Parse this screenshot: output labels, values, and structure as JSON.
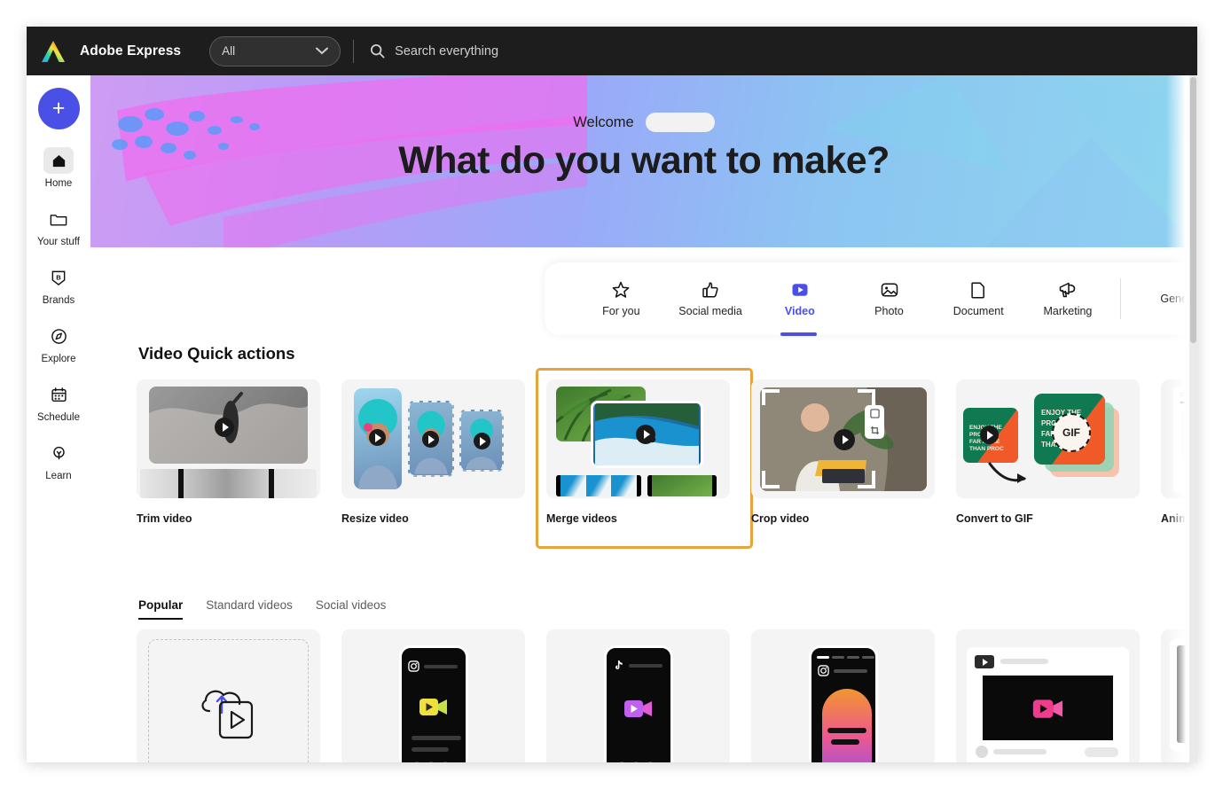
{
  "header": {
    "logo_icon": "adobe-express-logo",
    "brand": "Adobe Express",
    "filter_value": "All",
    "filter_chevron_icon": "chevron-down-icon",
    "search_icon": "search-icon",
    "search_placeholder": "Search everything"
  },
  "sidebar": {
    "create_label": "+",
    "items": [
      {
        "label": "Home",
        "icon": "home-icon",
        "active": true
      },
      {
        "label": "Your stuff",
        "icon": "folder-icon",
        "active": false
      },
      {
        "label": "Brands",
        "icon": "brand-shield-icon",
        "active": false
      },
      {
        "label": "Explore",
        "icon": "compass-icon",
        "active": false
      },
      {
        "label": "Schedule",
        "icon": "calendar-icon",
        "active": false
      },
      {
        "label": "Learn",
        "icon": "lightbulb-icon",
        "active": false
      }
    ]
  },
  "hero": {
    "welcome_label": "Welcome",
    "user_name_redacted": "",
    "headline": "What do you want to make?"
  },
  "categories": [
    {
      "label": "For you",
      "icon": "star-icon",
      "active": false
    },
    {
      "label": "Social media",
      "icon": "thumbs-up-icon",
      "active": false
    },
    {
      "label": "Video",
      "icon": "video-play-icon",
      "active": true
    },
    {
      "label": "Photo",
      "icon": "photo-icon",
      "active": false
    },
    {
      "label": "Document",
      "icon": "document-icon",
      "active": false
    },
    {
      "label": "Marketing",
      "icon": "megaphone-icon",
      "active": false
    },
    {
      "label": "Gene",
      "icon": "generative-icon",
      "active": false
    }
  ],
  "quick_actions": {
    "title": "Video Quick actions",
    "items": [
      {
        "label": "Trim video",
        "selected": false
      },
      {
        "label": "Resize video",
        "selected": false
      },
      {
        "label": "Merge videos",
        "selected": true
      },
      {
        "label": "Crop video",
        "selected": false
      },
      {
        "label": "Convert to GIF",
        "selected": false
      },
      {
        "label": "Animate fro",
        "selected": false
      }
    ]
  },
  "template_tabs": [
    {
      "label": "Popular",
      "active": true
    },
    {
      "label": "Standard videos",
      "active": false
    },
    {
      "label": "Social videos",
      "active": false
    }
  ],
  "templates": [
    {
      "type": "upload",
      "icon": "cloud-upload-video-icon"
    },
    {
      "type": "instagram-reel",
      "icon": "instagram-icon",
      "accent": "#f0e03c"
    },
    {
      "type": "tiktok",
      "icon": "tiktok-icon",
      "accent": "#c44cf0"
    },
    {
      "type": "instagram-story",
      "icon": "instagram-icon",
      "accent": "#f05ca0"
    },
    {
      "type": "youtube",
      "icon": "youtube-icon",
      "accent": "#f03c8c"
    },
    {
      "type": "phone-blank",
      "icon": "phone-icon",
      "accent": "#111111"
    }
  ],
  "colors": {
    "accent": "#4a50e6",
    "selection": "#e8a33d",
    "topbar": "#1d1d1d"
  },
  "selection_note": "Merge videos quick action is highlighted with an orange selection outline"
}
